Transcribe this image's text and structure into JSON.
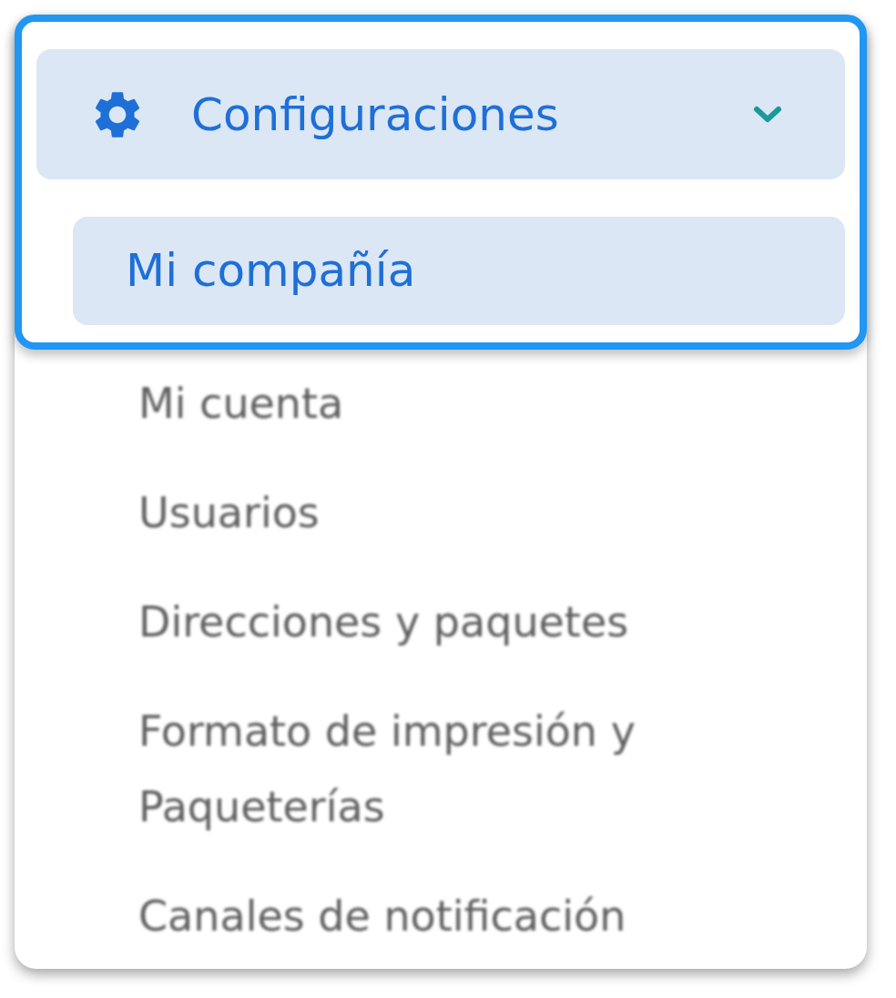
{
  "menu": {
    "title": "Configuraciones",
    "expanded": true,
    "items": [
      {
        "label": "Mi compañía",
        "selected": true
      },
      {
        "label": "Mi cuenta",
        "selected": false
      },
      {
        "label": "Usuarios",
        "selected": false
      },
      {
        "label": "Direcciones y paquetes",
        "selected": false
      },
      {
        "label": "Formato de impresión y Paqueterías",
        "selected": false
      },
      {
        "label": "Canales de notificación",
        "selected": false
      }
    ]
  }
}
